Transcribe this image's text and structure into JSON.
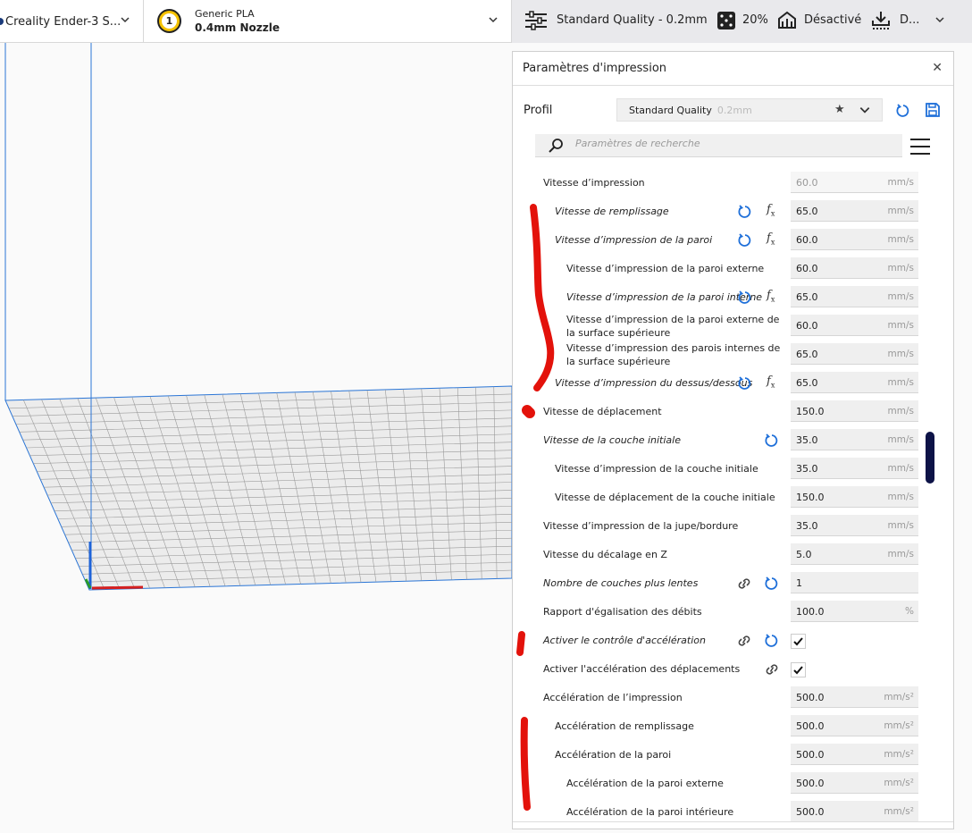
{
  "topbar": {
    "printer_name": "Creality Ender-3 S...",
    "material_index": "1",
    "material_name": "Generic PLA",
    "nozzle": "0.4mm Nozzle",
    "quality": "Standard Quality - 0.2mm",
    "infill": "20%",
    "support": "Désactivé",
    "adhesion": "D..."
  },
  "panel": {
    "title": "Paramètres d'impression",
    "profile_label": "Profil",
    "profile_name": "Standard Quality",
    "profile_sub": "0.2mm",
    "search_placeholder": "Paramètres de recherche"
  },
  "rows": [
    {
      "label": "Vitesse d’impression",
      "value": "60.0",
      "unit": "mm/s",
      "italic": false,
      "indent": 0,
      "disabled": true
    },
    {
      "label": "Vitesse de remplissage",
      "value": "65.0",
      "unit": "mm/s",
      "italic": true,
      "indent": 1,
      "reset": true,
      "fx": true
    },
    {
      "label": "Vitesse d’impression de la paroi",
      "value": "60.0",
      "unit": "mm/s",
      "italic": true,
      "indent": 1,
      "reset": true,
      "fx": true
    },
    {
      "label": "Vitesse d’impression de la paroi externe",
      "value": "60.0",
      "unit": "mm/s",
      "italic": false,
      "indent": 2
    },
    {
      "label": "Vitesse d’impression de la paroi interne",
      "value": "65.0",
      "unit": "mm/s",
      "italic": true,
      "indent": 2,
      "reset": true,
      "fx": true
    },
    {
      "label": "Vitesse d’impression de la paroi externe de la surface supérieure",
      "value": "60.0",
      "unit": "mm/s",
      "italic": false,
      "indent": 2
    },
    {
      "label": "Vitesse d’impression des parois internes de la surface supérieure",
      "value": "65.0",
      "unit": "mm/s",
      "italic": false,
      "indent": 2
    },
    {
      "label": "Vitesse d’impression du dessus/dessous",
      "value": "65.0",
      "unit": "mm/s",
      "italic": true,
      "indent": 1,
      "reset": true,
      "fx": true
    },
    {
      "label": "Vitesse de déplacement",
      "value": "150.0",
      "unit": "mm/s",
      "italic": false,
      "indent": 0
    },
    {
      "label": "Vitesse de la couche initiale",
      "value": "35.0",
      "unit": "mm/s",
      "italic": true,
      "indent": 0,
      "reset": true
    },
    {
      "label": "Vitesse d’impression de la couche initiale",
      "value": "35.0",
      "unit": "mm/s",
      "italic": false,
      "indent": 1
    },
    {
      "label": "Vitesse de déplacement de la couche initiale",
      "value": "150.0",
      "unit": "mm/s",
      "italic": false,
      "indent": 1
    },
    {
      "label": "Vitesse d’impression de la jupe/bordure",
      "value": "35.0",
      "unit": "mm/s",
      "italic": false,
      "indent": 0
    },
    {
      "label": "Vitesse du décalage en Z",
      "value": "5.0",
      "unit": "mm/s",
      "italic": false,
      "indent": 0
    },
    {
      "label": "Nombre de couches plus lentes",
      "value": "1",
      "unit": "",
      "italic": true,
      "indent": 0,
      "reset": true,
      "link": true
    },
    {
      "label": "Rapport d'égalisation des débits",
      "value": "100.0",
      "unit": "%",
      "italic": false,
      "indent": 0
    },
    {
      "label": "Activer le contrôle d'accélération",
      "checkbox": true,
      "italic": true,
      "indent": 0,
      "reset": true,
      "link": true
    },
    {
      "label": "Activer l'accélération des déplacements",
      "checkbox": true,
      "italic": false,
      "indent": 0,
      "link": true
    },
    {
      "label": "Accélération de l’impression",
      "value": "500.0",
      "unit": "mm/s²",
      "italic": false,
      "indent": 0
    },
    {
      "label": "Accélération de remplissage",
      "value": "500.0",
      "unit": "mm/s²",
      "italic": false,
      "indent": 1
    },
    {
      "label": "Accélération de la paroi",
      "value": "500.0",
      "unit": "mm/s²",
      "italic": false,
      "indent": 1
    },
    {
      "label": "Accélération de la paroi externe",
      "value": "500.0",
      "unit": "mm/s²",
      "italic": false,
      "indent": 2
    },
    {
      "label": "Accélération de la paroi intérieure",
      "value": "500.0",
      "unit": "mm/s²",
      "italic": false,
      "indent": 2
    }
  ],
  "colors": {
    "accent": "#1e6fd9",
    "annotation": "#e3120b",
    "scroll": "#0d1347",
    "quality_bg": "#e9e9ec"
  }
}
